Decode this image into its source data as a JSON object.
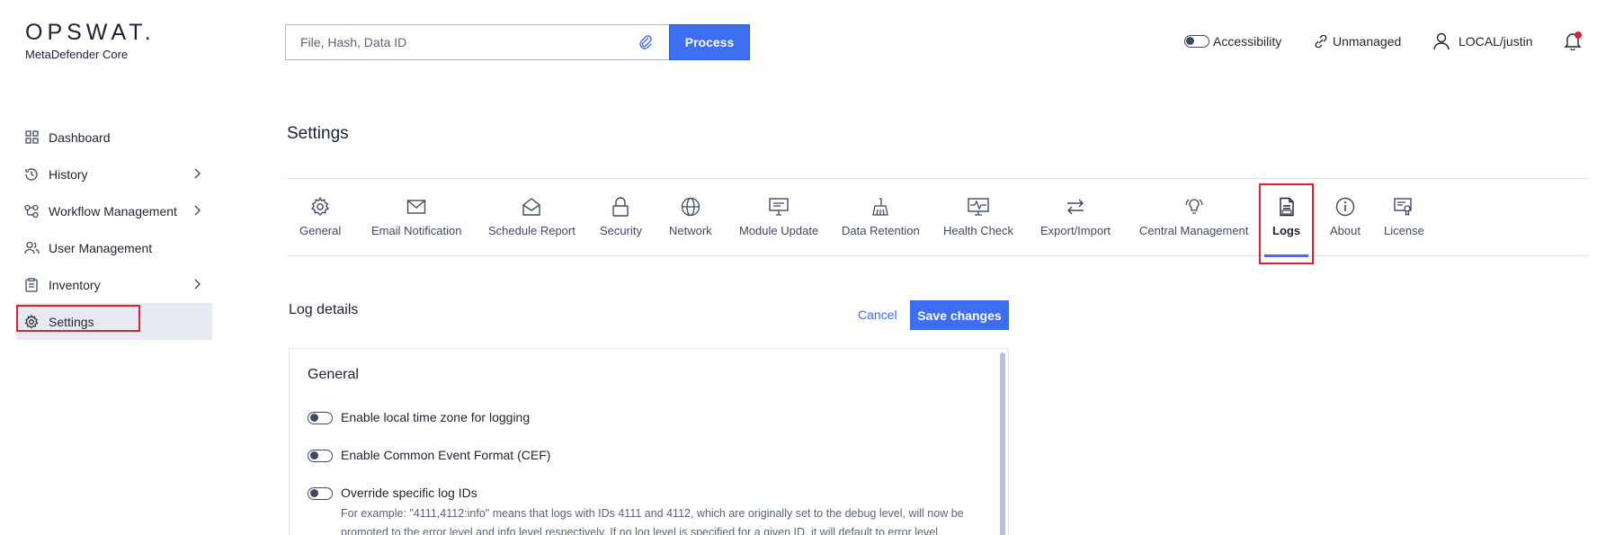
{
  "brand": {
    "name": "OPSWAT.",
    "product": "MetaDefender Core"
  },
  "search": {
    "placeholder": "File, Hash, Data ID",
    "process_label": "Process"
  },
  "topbar": {
    "accessibility": "Accessibility",
    "unmanaged": "Unmanaged",
    "user": "LOCAL/justin"
  },
  "sidebar": {
    "items": [
      {
        "label": "Dashboard",
        "icon": "grid-icon"
      },
      {
        "label": "History",
        "icon": "history-icon"
      },
      {
        "label": "Workflow Management",
        "icon": "workflow-icon"
      },
      {
        "label": "User Management",
        "icon": "users-icon"
      },
      {
        "label": "Inventory",
        "icon": "clipboard-icon"
      },
      {
        "label": "Settings",
        "icon": "gear-icon"
      }
    ]
  },
  "page": {
    "title": "Settings"
  },
  "tabs": [
    {
      "label": "General"
    },
    {
      "label": "Email Notification"
    },
    {
      "label": "Schedule Report"
    },
    {
      "label": "Security"
    },
    {
      "label": "Network"
    },
    {
      "label": "Module Update"
    },
    {
      "label": "Data Retention"
    },
    {
      "label": "Health Check"
    },
    {
      "label": "Export/Import"
    },
    {
      "label": "Central Management"
    },
    {
      "label": "Logs"
    },
    {
      "label": "About"
    },
    {
      "label": "License"
    }
  ],
  "log_details": {
    "title": "Log details",
    "cancel": "Cancel",
    "save": "Save changes",
    "general_title": "General",
    "options": [
      {
        "label": "Enable local time zone for logging"
      },
      {
        "label": "Enable Common Event Format (CEF)"
      },
      {
        "label": "Override specific log IDs",
        "hint": "For example: \"4111,4112:info\" means that logs with IDs 4111 and 4112, which are originally set to the debug level, will now be promoted to the error level and info level respectively. If no log level is specified for a given ID, it will default to error level."
      }
    ]
  },
  "colors": {
    "accent": "#3d6ef0",
    "highlight": "#e0202a",
    "active_bg": "#e7eaf3"
  }
}
